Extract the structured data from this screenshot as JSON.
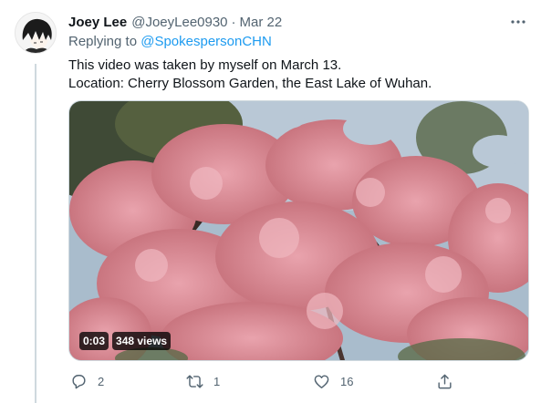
{
  "tweet": {
    "author_name": "Joey Lee",
    "author_handle": "@JoeyLee0930",
    "separator": "·",
    "date": "Mar 22",
    "replying_prefix": "Replying to",
    "replying_to": "@SpokespersonCHN",
    "text_lines": [
      "This video was taken by myself on March 13.",
      "Location: Cherry Blossom Garden, the East Lake of Wuhan."
    ]
  },
  "media": {
    "duration": "0:03",
    "views": "348 views"
  },
  "actions": {
    "reply_count": "2",
    "retweet_count": "1",
    "like_count": "16",
    "share_count": ""
  },
  "icons": {
    "more": "more-icon",
    "reply": "reply-icon",
    "retweet": "retweet-icon",
    "like": "heart-icon",
    "share": "share-icon"
  },
  "colors": {
    "link": "#1d9bf0",
    "muted": "#536471",
    "text": "#0f1419"
  }
}
